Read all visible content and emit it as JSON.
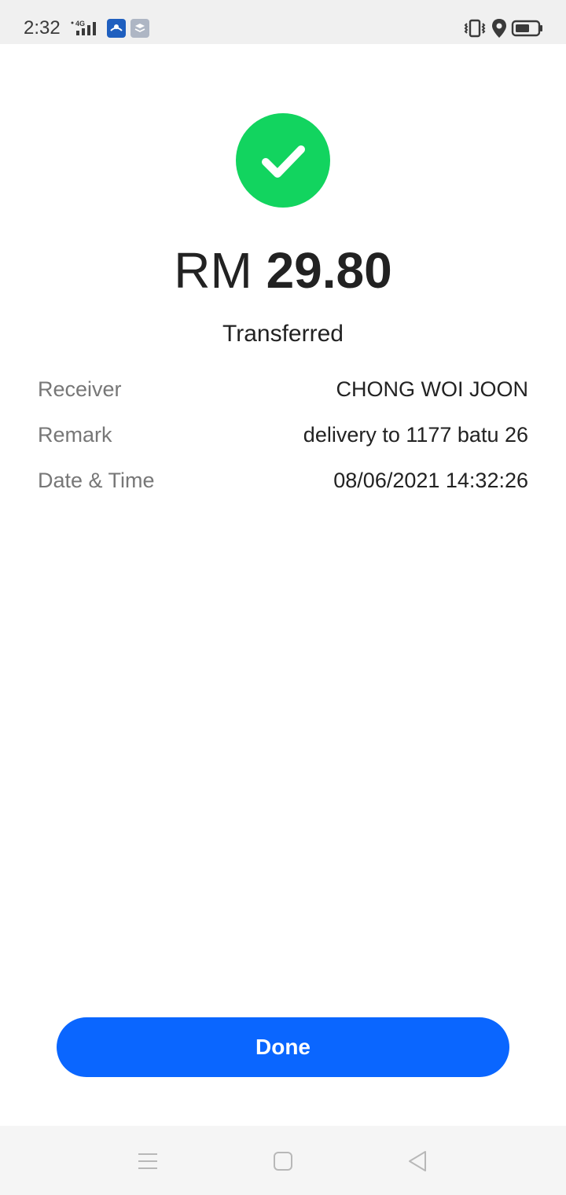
{
  "status_bar": {
    "time": "2:32",
    "network": "4G",
    "icons": [
      "signal-icon",
      "app-notification-icon",
      "app-layers-icon",
      "vibrate-icon",
      "location-icon",
      "battery-icon"
    ]
  },
  "receipt": {
    "currency": "RM",
    "amount": "29.80",
    "status": "Transferred",
    "status_icon": "check-icon",
    "accent_color": "#12d45f",
    "details": [
      {
        "label": "Receiver",
        "value": "CHONG WOI JOON"
      },
      {
        "label": "Remark",
        "value": "delivery to 1177 batu 26"
      },
      {
        "label": "Date & Time",
        "value": "08/06/2021 14:32:26"
      }
    ]
  },
  "actions": {
    "done_label": "Done",
    "button_color": "#0a66ff"
  },
  "nav_bar": {
    "icons": [
      "menu-icon",
      "home-icon",
      "back-icon"
    ]
  }
}
